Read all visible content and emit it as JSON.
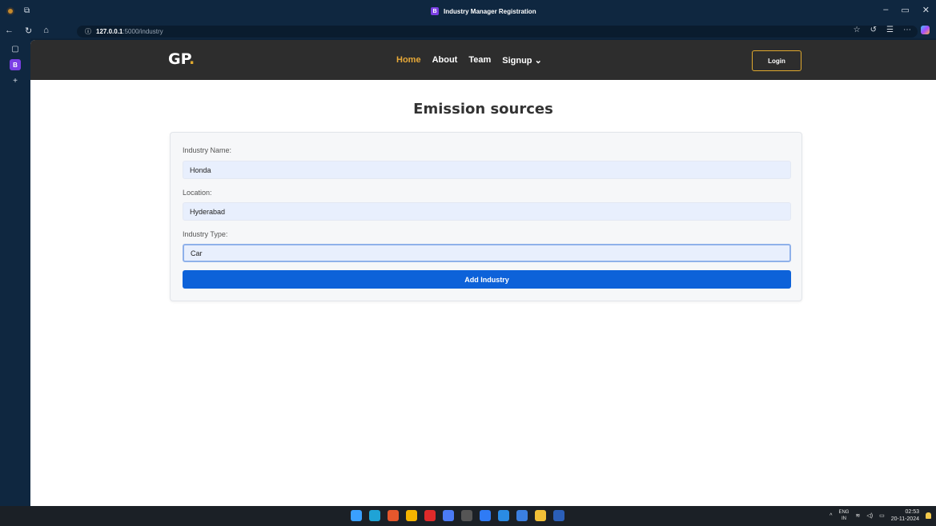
{
  "browser": {
    "tab_title": "Industry Manager Registration",
    "tab_badge": "B",
    "url_host": "127.0.0.1",
    "url_path": ":5000/industry",
    "sidebar_badge": "B"
  },
  "site": {
    "brand": "GP",
    "brand_dot": ".",
    "nav": [
      {
        "label": "Home",
        "active": true
      },
      {
        "label": "About"
      },
      {
        "label": "Team"
      },
      {
        "label": "Signup ⌄"
      }
    ],
    "login_label": "Login"
  },
  "page": {
    "heading": "Emission sources",
    "form": {
      "industry_name_label": "Industry Name:",
      "industry_name_value": "Honda",
      "location_label": "Location:",
      "location_value": "Hyderabad",
      "industry_type_label": "Industry Type:",
      "industry_type_value": "Car",
      "submit_label": "Add Industry"
    }
  },
  "taskbar": {
    "lang_top": "ENG",
    "lang_bottom": "IN",
    "time": "02:53",
    "date": "20-11-2024",
    "icons": [
      "windows-start-icon",
      "edge-icon",
      "brave-icon",
      "chrome-icon",
      "youtube-icon",
      "gemini-icon",
      "epic-games-icon",
      "todo-icon",
      "vscode-icon",
      "notepad-icon",
      "file-explorer-icon",
      "word-icon"
    ],
    "icon_colors": [
      "#3aa0ff",
      "#1fa3d6",
      "#e5572c",
      "#f4b400",
      "#e02a2a",
      "#4b7bf5",
      "#555555",
      "#2f7bf5",
      "#2a8be4",
      "#3b7fe0",
      "#f2c037",
      "#2b5fb8"
    ]
  },
  "colors": {
    "accent": "#e6a838",
    "primary_button": "#0d62d9",
    "header_bg": "#2d2d2d"
  }
}
